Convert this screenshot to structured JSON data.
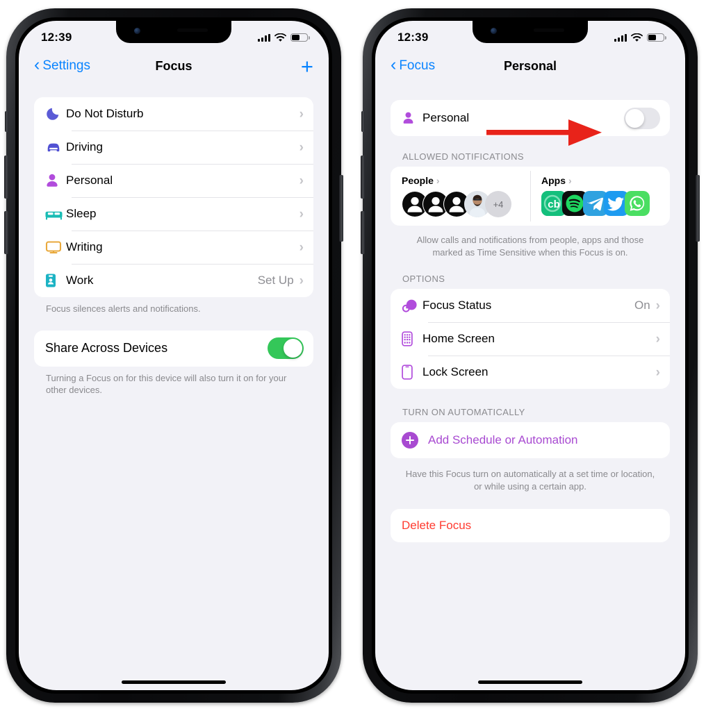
{
  "meta": {
    "accent_blue": "#0a84ff",
    "accent_purple": "#a84ad1",
    "toggle_on_green": "#34c759",
    "destructive_red": "#ff3b30",
    "annotation_red": "#e8231a",
    "screen_bg": "#f2f2f7"
  },
  "phone_left": {
    "status": {
      "time": "12:39",
      "cellular": "signal-bars-icon",
      "wifi": "wifi-icon",
      "battery": "battery-icon",
      "battery_level": 52
    },
    "nav": {
      "back_label": "Settings",
      "title": "Focus",
      "add_label": "+"
    },
    "focus_list": [
      {
        "label": "Do Not Disturb",
        "icon": "moon-icon",
        "color": "#5b5bd6",
        "value": ""
      },
      {
        "label": "Driving",
        "icon": "car-icon",
        "color": "#5151d3",
        "value": ""
      },
      {
        "label": "Personal",
        "icon": "person-icon",
        "color": "#b14cdc",
        "value": ""
      },
      {
        "label": "Sleep",
        "icon": "bed-icon",
        "color": "#18bcb4",
        "value": ""
      },
      {
        "label": "Writing",
        "icon": "monitor-icon",
        "color": "#e9a93c",
        "value": ""
      },
      {
        "label": "Work",
        "icon": "badge-icon",
        "color": "#1cb3c4",
        "value": "Set Up"
      }
    ],
    "focus_footnote": "Focus silences alerts and notifications.",
    "share": {
      "label": "Share Across Devices",
      "state": "on"
    },
    "share_footnote": "Turning a Focus on for this device will also turn it on for your other devices."
  },
  "phone_right": {
    "status": {
      "time": "12:39",
      "cellular": "signal-bars-icon",
      "wifi": "wifi-icon",
      "battery": "battery-icon",
      "battery_level": 52
    },
    "nav": {
      "back_label": "Focus",
      "title": "Personal"
    },
    "enable_row": {
      "label": "Personal",
      "icon": "person-icon",
      "color": "#b14cdc",
      "state": "off"
    },
    "allowed": {
      "header": "ALLOWED NOTIFICATIONS",
      "people": {
        "label": "People",
        "overflow": "+4",
        "avatars": [
          "generic-avatar",
          "generic-avatar",
          "generic-avatar",
          "photo-avatar",
          "overflow-avatar"
        ]
      },
      "apps": {
        "label": "Apps",
        "icons": [
          "cb-app-icon",
          "spotify-icon",
          "telegram-icon",
          "twitter-icon",
          "whatsapp-icon"
        ]
      },
      "footnote": "Allow calls and notifications from people, apps and those marked as Time Sensitive when this Focus is on."
    },
    "options": {
      "header": "OPTIONS",
      "rows": [
        {
          "label": "Focus Status",
          "icon": "focus-status-icon",
          "color": "#b14cdc",
          "value": "On"
        },
        {
          "label": "Home Screen",
          "icon": "home-screen-icon",
          "color": "#b14cdc",
          "value": ""
        },
        {
          "label": "Lock Screen",
          "icon": "lock-screen-icon",
          "color": "#b14cdc",
          "value": ""
        }
      ]
    },
    "automation": {
      "header": "TURN ON AUTOMATICALLY",
      "add_label": "Add Schedule or Automation",
      "footnote": "Have this Focus turn on automatically at a set time or location, or while using a certain app."
    },
    "delete_label": "Delete Focus"
  },
  "annotation": {
    "type": "arrow",
    "points_to": "personal-focus-toggle",
    "color": "#e8231a"
  }
}
